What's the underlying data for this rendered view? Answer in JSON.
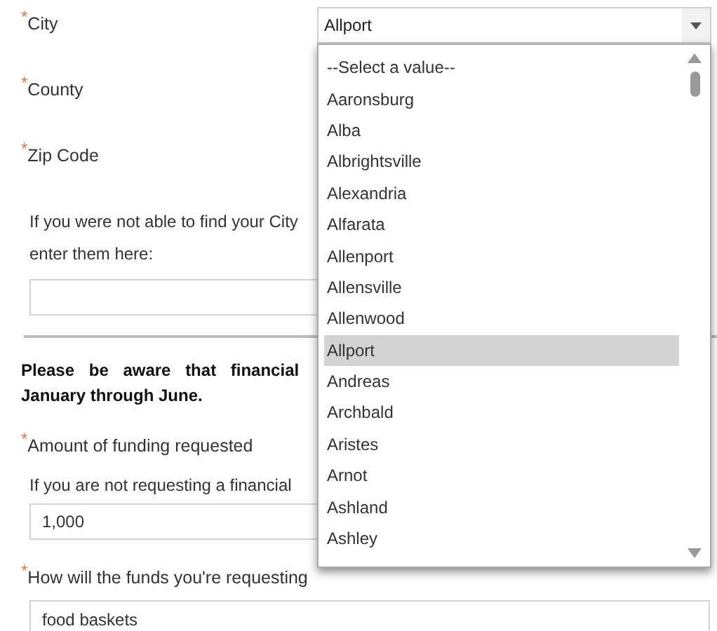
{
  "form": [
    {
      "kind": "label",
      "text": "City",
      "required_mark": "*"
    },
    {
      "kind": "label",
      "text": "County",
      "required_mark": "*"
    },
    {
      "kind": "label",
      "text": "Zip Code",
      "required_mark": "*"
    },
    {
      "kind": "note",
      "lines": [
        "If you were not able to find your City",
        "enter them here:"
      ]
    },
    {
      "kind": "input"
    },
    {
      "kind": "divider"
    },
    {
      "kind": "notice",
      "lines": [
        "Please be aware that financial",
        "January through June."
      ]
    },
    {
      "kind": "label",
      "text": "Amount of funding requested",
      "required_mark": "*"
    },
    {
      "kind": "hint",
      "text": "If you are not requesting a financial"
    },
    {
      "kind": "input",
      "value": "1,000"
    },
    {
      "kind": "label",
      "text": "How will the funds you're requesting",
      "required_mark": "*"
    },
    {
      "kind": "textarea",
      "value": "food baskets"
    }
  ],
  "city_select": {
    "value": "Allport",
    "expanded": true,
    "options": [
      {
        "label": "--Select a value--",
        "selected": false
      },
      {
        "label": "Aaronsburg",
        "selected": false
      },
      {
        "label": "Alba",
        "selected": false
      },
      {
        "label": "Albrightsville",
        "selected": false
      },
      {
        "label": "Alexandria",
        "selected": false
      },
      {
        "label": "Alfarata",
        "selected": false
      },
      {
        "label": "Allenport",
        "selected": false
      },
      {
        "label": "Allensville",
        "selected": false
      },
      {
        "label": "Allenwood",
        "selected": false
      },
      {
        "label": "Allport",
        "selected": true
      },
      {
        "label": "Andreas",
        "selected": false
      },
      {
        "label": "Archbald",
        "selected": false
      },
      {
        "label": "Aristes",
        "selected": false
      },
      {
        "label": "Arnot",
        "selected": false
      },
      {
        "label": "Ashland",
        "selected": false
      },
      {
        "label": "Ashley",
        "selected": false
      }
    ]
  }
}
